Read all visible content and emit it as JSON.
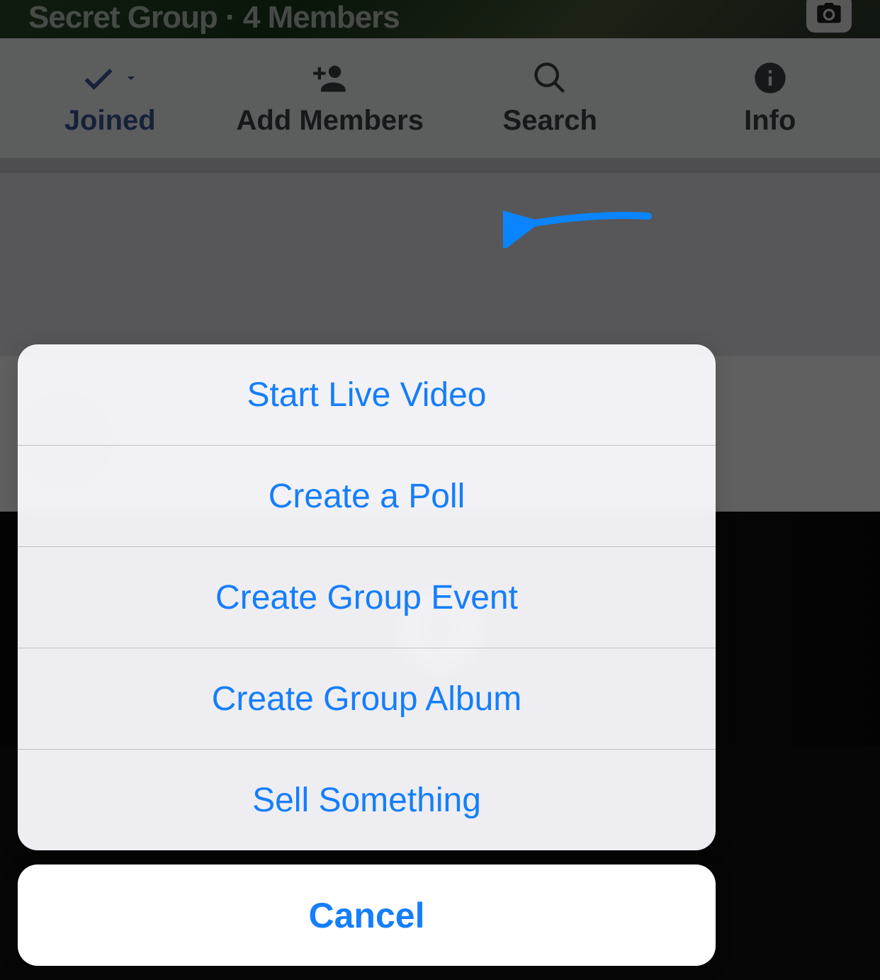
{
  "header": {
    "group_type": "Secret Group",
    "member_count_text": "4 Members"
  },
  "actionBar": {
    "joined": {
      "label": "Joined"
    },
    "addMembers": {
      "label": "Add Members"
    },
    "search": {
      "label": "Search"
    },
    "info": {
      "label": "Info"
    }
  },
  "sheet": {
    "options": [
      {
        "key": "start-live-video",
        "label": "Start Live Video"
      },
      {
        "key": "create-poll",
        "label": "Create a Poll"
      },
      {
        "key": "create-group-event",
        "label": "Create Group Event"
      },
      {
        "key": "create-group-album",
        "label": "Create Group Album"
      },
      {
        "key": "sell-something",
        "label": "Sell Something"
      }
    ],
    "cancel_label": "Cancel"
  },
  "colors": {
    "ios_blue": "#157efb",
    "fb_blue": "#3b5998"
  },
  "annotation": {
    "arrow_target": "start-live-video"
  }
}
